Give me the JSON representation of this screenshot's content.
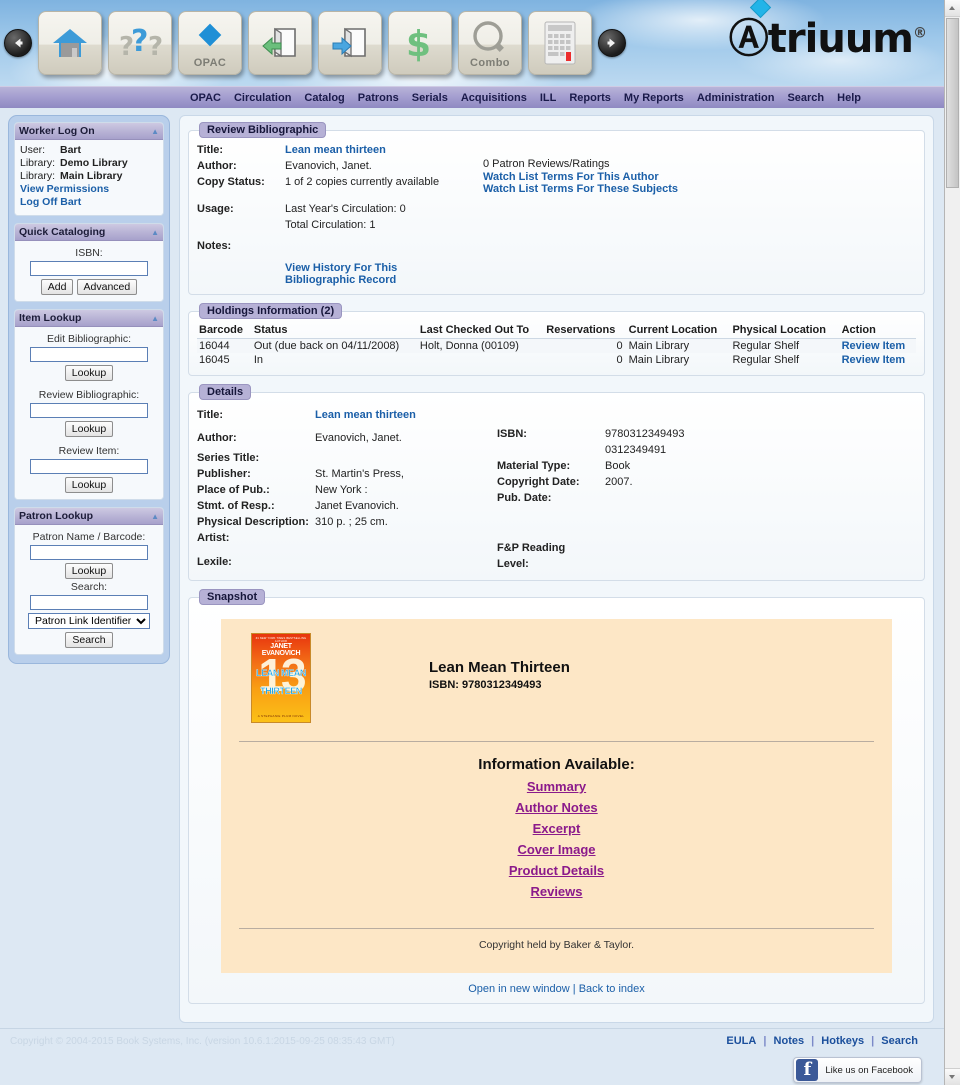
{
  "header": {
    "logo_text": "triuum",
    "logo_registered": "®",
    "toolbar": {
      "back_icon": "back-arrow-icon",
      "forward_icon": "forward-arrow-icon",
      "buttons": [
        {
          "name": "home-button",
          "icon": "home-icon",
          "label": ""
        },
        {
          "name": "help-button",
          "icon": "question-marks-icon",
          "label": ""
        },
        {
          "name": "opac-button",
          "icon": "diamond-icon",
          "label": "OPAC"
        },
        {
          "name": "check-in-button",
          "icon": "book-return-icon",
          "label": ""
        },
        {
          "name": "check-out-button",
          "icon": "book-checkout-icon",
          "label": ""
        },
        {
          "name": "fines-button",
          "icon": "dollar-icon",
          "label": ""
        },
        {
          "name": "combo-button",
          "icon": "magnifier-icon",
          "label": "Combo"
        },
        {
          "name": "calculator-button",
          "icon": "calculator-icon",
          "label": ""
        }
      ]
    },
    "menu": [
      "OPAC",
      "Circulation",
      "Catalog",
      "Patrons",
      "Serials",
      "Acquisitions",
      "ILL",
      "Reports",
      "My Reports",
      "Administration",
      "Search",
      "Help"
    ]
  },
  "sidebar": {
    "worker_log_on": {
      "title": "Worker Log On",
      "user_label": "User:",
      "user_value": "Bart",
      "library_label_1": "Library:",
      "library_value_1": "Demo Library",
      "library_label_2": "Library:",
      "library_value_2": "Main Library",
      "view_permissions": "View Permissions",
      "log_off": "Log Off Bart"
    },
    "quick_cataloging": {
      "title": "Quick Cataloging",
      "isbn_label": "ISBN:",
      "isbn_value": "",
      "add_label": "Add",
      "advanced_label": "Advanced"
    },
    "item_lookup": {
      "title": "Item Lookup",
      "edit_bib_label": "Edit Bibliographic:",
      "edit_bib_value": "",
      "edit_bib_button": "Lookup",
      "review_bib_label": "Review Bibliographic:",
      "review_bib_value": "",
      "review_bib_button": "Lookup",
      "review_item_label": "Review Item:",
      "review_item_value": "",
      "review_item_button": "Lookup"
    },
    "patron_lookup": {
      "title": "Patron Lookup",
      "patron_name_label": "Patron Name / Barcode:",
      "patron_name_value": "",
      "lookup_button": "Lookup",
      "search_label": "Search:",
      "search_value": "",
      "select_value": "Patron Link Identifier",
      "select_options": [
        "Patron Link Identifier"
      ],
      "search_button": "Search"
    }
  },
  "review_bibliographic": {
    "section_title": "Review Bibliographic",
    "title_label": "Title:",
    "title_value": "Lean mean thirteen",
    "author_label": "Author:",
    "author_value": "Evanovich, Janet.",
    "copy_status_label": "Copy Status:",
    "copy_status_value": "1 of 2 copies currently available",
    "usage_label": "Usage:",
    "usage_last_year": "Last Year's Circulation: 0",
    "usage_total": "Total Circulation: 1",
    "notes_label": "Notes:",
    "patron_reviews": "0 Patron Reviews/Ratings",
    "watch_author": "Watch List Terms For This Author",
    "watch_subjects": "Watch List Terms For These Subjects",
    "view_history_line1": "View History For This",
    "view_history_line2": "Bibliographic Record"
  },
  "holdings": {
    "section_title": "Holdings Information (2)",
    "columns": [
      "Barcode",
      "Status",
      "Last Checked Out To",
      "Reservations",
      "Current Location",
      "Physical Location",
      "Action"
    ],
    "rows": [
      {
        "barcode": "16044",
        "status": "Out (due back on 04/11/2008)",
        "last_checked_out_to": "Holt, Donna (00109)",
        "reservations": "0",
        "current_location": "Main Library",
        "physical_location": "Regular Shelf",
        "action": "Review Item"
      },
      {
        "barcode": "16045",
        "status": "In",
        "last_checked_out_to": "",
        "reservations": "0",
        "current_location": "Main Library",
        "physical_location": "Regular Shelf",
        "action": "Review Item"
      }
    ]
  },
  "details": {
    "section_title": "Details",
    "title_label": "Title:",
    "title_value": "Lean mean thirteen",
    "author_label": "Author:",
    "author_value": "Evanovich, Janet.",
    "series_title_label": "Series Title:",
    "series_title_value": "",
    "publisher_label": "Publisher:",
    "publisher_value": "St. Martin's Press,",
    "place_of_pub_label": "Place of Pub.:",
    "place_of_pub_value": "New York :",
    "stmt_of_resp_label": "Stmt. of Resp.:",
    "stmt_of_resp_value": "Janet Evanovich.",
    "physical_description_label": "Physical Description:",
    "physical_description_value": "310 p. ; 25 cm.",
    "artist_label": "Artist:",
    "artist_value": "",
    "lexile_label": "Lexile:",
    "lexile_value": "",
    "isbn_label": "ISBN:",
    "isbn_value_1": "9780312349493",
    "isbn_value_2": "0312349491",
    "material_type_label": "Material Type:",
    "material_type_value": "Book",
    "copyright_date_label": "Copyright Date:",
    "copyright_date_value": "2007.",
    "pub_date_label": "Pub. Date:",
    "pub_date_value": "",
    "fp_reading_label_line1": "F&P Reading",
    "fp_reading_label_line2": "Level:",
    "fp_reading_value": ""
  },
  "snapshot": {
    "section_title": "Snapshot",
    "cover": {
      "top_blurb": "#1 NEW YORK TIMES BESTSELLING AUTHOR",
      "author": "JANET EVANOVICH",
      "big_number": "13",
      "title_line1": "LEAN MEAN",
      "title_line2": "THIRTEEN",
      "subtitle": "A STEPHANIE PLUM NOVEL"
    },
    "title": "Lean Mean Thirteen",
    "isbn_line": "ISBN: 9780312349493",
    "info_header": "Information Available:",
    "info_links": [
      "Summary",
      "Author Notes",
      "Excerpt",
      "Cover Image",
      "Product Details",
      "Reviews"
    ],
    "copyright": "Copyright held by Baker & Taylor.",
    "open_new_window": "Open in new window",
    "separator": "|",
    "back_to_index": "Back to index"
  },
  "footer": {
    "copyright": "Copyright © 2004-2015 Book Systems, Inc. (version 10.6.1:2015-09-25 08:35:43 GMT)",
    "links": [
      "EULA",
      "Notes",
      "Hotkeys",
      "Search"
    ],
    "separator": "|",
    "facebook_label": "Like us on Facebook",
    "facebook_glyph": "f"
  },
  "colors": {
    "accent_purple": "#a7a1cb",
    "link_blue": "#1b5fa8",
    "snapshot_bg": "#fde7c6",
    "info_link": "#8b1a8b",
    "sidebar_bg": "#b9cfeb"
  }
}
